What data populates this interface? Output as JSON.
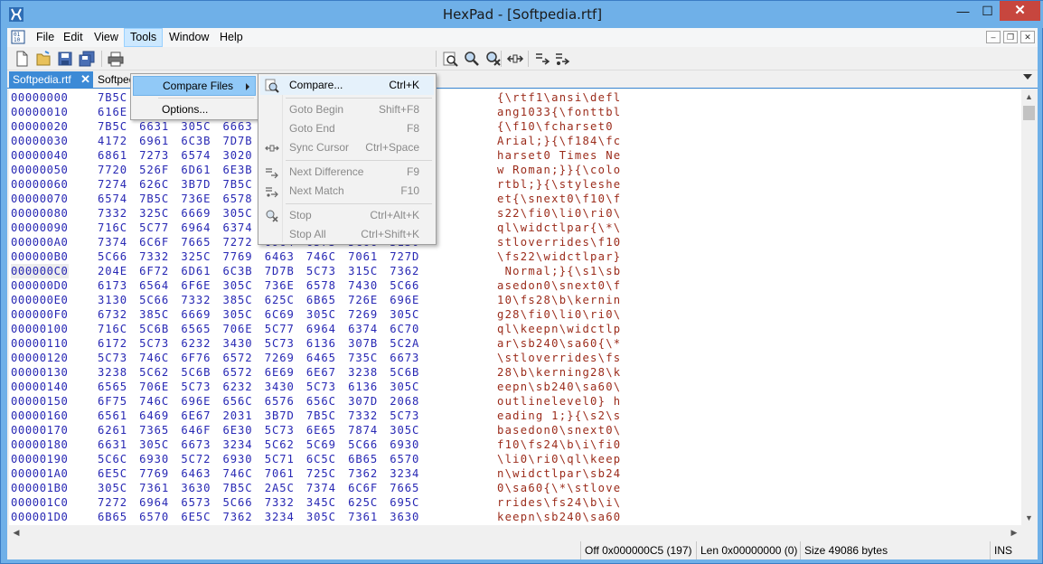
{
  "window": {
    "title": "HexPad - [Softpedia.rtf]",
    "min_glyph": "—",
    "max_glyph": "☐",
    "close_glyph": "✕"
  },
  "menu": {
    "items": [
      "File",
      "Edit",
      "View",
      "Tools",
      "Window",
      "Help"
    ],
    "active": "Tools"
  },
  "mdi_controls": [
    "‒",
    "❐",
    "✕"
  ],
  "tabs": {
    "active": "Softpedia.rtf",
    "inactive": "Softpedia"
  },
  "tools_menu": {
    "items": [
      {
        "label": "Compare Files",
        "submenu": true,
        "highlighted": true
      },
      {
        "label": "Options...",
        "submenu": false,
        "highlighted": false
      }
    ]
  },
  "compare_submenu": {
    "items": [
      {
        "label": "Compare...",
        "shortcut": "Ctrl+K",
        "enabled": true,
        "icon": "compare-icon"
      },
      {
        "label": "Goto Begin",
        "shortcut": "Shift+F8",
        "enabled": false,
        "icon": ""
      },
      {
        "label": "Goto End",
        "shortcut": "F8",
        "enabled": false,
        "icon": ""
      },
      {
        "label": "Sync Cursor",
        "shortcut": "Ctrl+Space",
        "enabled": false,
        "icon": "sync-cursor-icon"
      },
      {
        "label": "Next Difference",
        "shortcut": "F9",
        "enabled": false,
        "icon": "next-difference-icon"
      },
      {
        "label": "Next Match",
        "shortcut": "F10",
        "enabled": false,
        "icon": "next-match-icon"
      },
      {
        "label": "Stop",
        "shortcut": "Ctrl+Alt+K",
        "enabled": false,
        "icon": "stop-icon"
      },
      {
        "label": "Stop All",
        "shortcut": "Ctrl+Shift+K",
        "enabled": false,
        "icon": ""
      }
    ]
  },
  "toolbar": {
    "icons": [
      "new-file-icon",
      "open-file-icon",
      "save-icon",
      "save-all-icon",
      "print-icon",
      "find-icon",
      "find-next-icon",
      "compare-tool-icon",
      "stop-tool-icon",
      "sync-tool-icon",
      "next-diff-tool-icon",
      "next-match-tool-icon"
    ]
  },
  "hex_rows": [
    {
      "offset": "00000000",
      "hex": "7B5C 7274 6631 615C 6E73 695C 6465 666C",
      "text": "{\\rtf1\\ansi\\defl"
    },
    {
      "offset": "00000010",
      "hex": "616E 6731 3033 337B 5C66 6F6E 7474 626C",
      "text": "ang1033{\\fonttbl"
    },
    {
      "offset": "00000020",
      "hex": "7B5C 6631 305C 6663 6861 7273 6574 3020",
      "text": "{\\f10\\fcharset0 "
    },
    {
      "offset": "00000030",
      "hex": "4172 6961 6C3B 7D7B 5C66 3138 345C 6663",
      "text": "Arial;}{\\f184\\fc"
    },
    {
      "offset": "00000040",
      "hex": "6861 7273 6574 3020 5469 6D65 7320 4E65",
      "text": "harset0 Times Ne"
    },
    {
      "offset": "00000050",
      "hex": "7720 526F 6D61 6E3B 7D7D 7B5C 636F 6C6F",
      "text": "w Roman;}}{\\colo"
    },
    {
      "offset": "00000060",
      "hex": "7274 626C 3B7D 7B5C 7374 796C 6573 6865",
      "text": "rtbl;}{\\styleshe"
    },
    {
      "offset": "00000070",
      "hex": "6574 7B5C 736E 6578 7430 5C66 3130 5C66",
      "text": "et{\\snext0\\f10\\f"
    },
    {
      "offset": "00000080",
      "hex": "7332 325C 6669 305C 6C69 305C 7269 305C",
      "text": "s22\\fi0\\li0\\ri0\\"
    },
    {
      "offset": "00000090",
      "hex": "716C 5C77 6964 6374 6C70 6172 7B5C 2A5C",
      "text": "ql\\widctlpar{\\*\\"
    },
    {
      "offset": "000000A0",
      "hex": "7374 6C6F 7665 7272 6964 6573 5C66 3130",
      "text": "stloverrides\\f10"
    },
    {
      "offset": "000000B0",
      "hex": "5C66 7332 325C 7769 6463 746C 7061 727D",
      "text": "\\fs22\\widctlpar}"
    },
    {
      "offset": "000000C0",
      "hex": "204E 6F72 6D61 6C3B 7D7B 5C73 315C 7362",
      "text": " Normal;}{\\s1\\sb"
    },
    {
      "offset": "000000D0",
      "hex": "6173 6564 6F6E 305C 736E 6578 7430 5C66",
      "text": "asedon0\\snext0\\f"
    },
    {
      "offset": "000000E0",
      "hex": "3130 5C66 7332 385C 625C 6B65 726E 696E",
      "text": "10\\fs28\\b\\kernin"
    },
    {
      "offset": "000000F0",
      "hex": "6732 385C 6669 305C 6C69 305C 7269 305C",
      "text": "g28\\fi0\\li0\\ri0\\"
    },
    {
      "offset": "00000100",
      "hex": "716C 5C6B 6565 706E 5C77 6964 6374 6C70",
      "text": "ql\\keepn\\widctlp"
    },
    {
      "offset": "00000110",
      "hex": "6172 5C73 6232 3430 5C73 6136 307B 5C2A",
      "text": "ar\\sb240\\sa60{\\*"
    },
    {
      "offset": "00000120",
      "hex": "5C73 746C 6F76 6572 7269 6465 735C 6673",
      "text": "\\stloverrides\\fs"
    },
    {
      "offset": "00000130",
      "hex": "3238 5C62 5C6B 6572 6E69 6E67 3238 5C6B",
      "text": "28\\b\\kerning28\\k"
    },
    {
      "offset": "00000140",
      "hex": "6565 706E 5C73 6232 3430 5C73 6136 305C",
      "text": "eepn\\sb240\\sa60\\"
    },
    {
      "offset": "00000150",
      "hex": "6F75 746C 696E 656C 6576 656C 307D 2068",
      "text": "outlinelevel0} h"
    },
    {
      "offset": "00000160",
      "hex": "6561 6469 6E67 2031 3B7D 7B5C 7332 5C73",
      "text": "eading 1;}{\\s2\\s"
    },
    {
      "offset": "00000170",
      "hex": "6261 7365 646F 6E30 5C73 6E65 7874 305C",
      "text": "basedon0\\snext0\\"
    },
    {
      "offset": "00000180",
      "hex": "6631 305C 6673 3234 5C62 5C69 5C66 6930",
      "text": "f10\\fs24\\b\\i\\fi0"
    },
    {
      "offset": "00000190",
      "hex": "5C6C 6930 5C72 6930 5C71 6C5C 6B65 6570",
      "text": "\\li0\\ri0\\ql\\keep"
    },
    {
      "offset": "000001A0",
      "hex": "6E5C 7769 6463 746C 7061 725C 7362 3234",
      "text": "n\\widctlpar\\sb24"
    },
    {
      "offset": "000001B0",
      "hex": "305C 7361 3630 7B5C 2A5C 7374 6C6F 7665",
      "text": "0\\sa60{\\*\\stlove"
    },
    {
      "offset": "000001C0",
      "hex": "7272 6964 6573 5C66 7332 345C 625C 695C",
      "text": "rrides\\fs24\\b\\i\\"
    },
    {
      "offset": "000001D0",
      "hex": "6B65 6570 6E5C 7362 3234 305C 7361 3630",
      "text": "keepn\\sb240\\sa60"
    }
  ],
  "selected_offset": "000000C0",
  "status": {
    "offset": "Off 0x000000C5 (197)",
    "length": "Len 0x00000000 (0)",
    "size": "Size 49086 bytes",
    "mode": "INS"
  },
  "colors": {
    "title_bar": "#6fb0e8",
    "active_tab": "#3c8ad6",
    "hex_blue": "#2828b4",
    "text_red": "#9b2b1a",
    "menu_highlight": "#91c9f7"
  }
}
